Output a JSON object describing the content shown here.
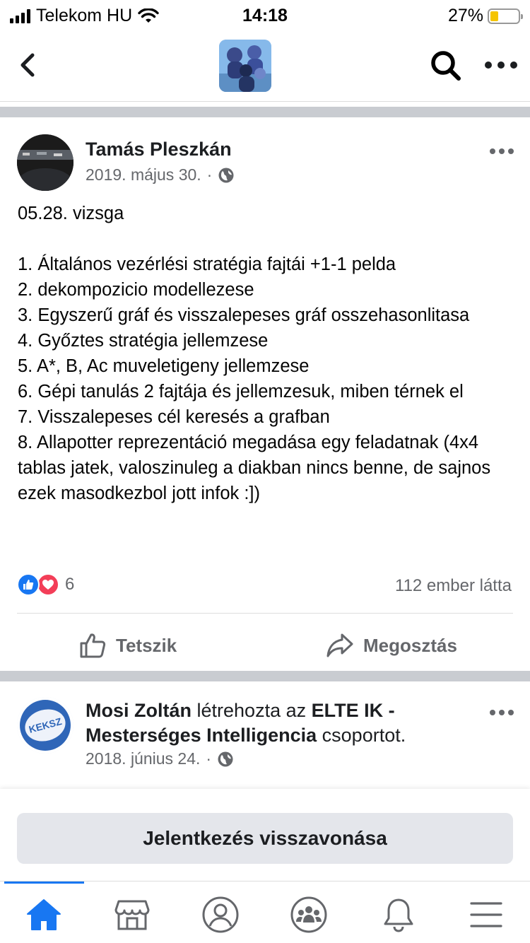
{
  "status_bar": {
    "carrier": "Telekom HU",
    "time": "14:18",
    "battery_percent": "27%",
    "battery_level": 0.27
  },
  "nav": {
    "icons": [
      "back-chevron-icon",
      "group-cover-image",
      "search-icon",
      "more-horizontal-icon"
    ]
  },
  "post": {
    "author": "Tamás Pleszkán",
    "date": "2019. május 30.",
    "separator": "·",
    "audience_icon": "globe-icon",
    "body_lines": [
      "05.28. vizsga",
      "",
      "1. Általános vezérlési stratégia fajtái +1-1 pelda",
      "2. dekompozicio modellezese",
      "3. Egyszerű gráf és visszalepeses gráf osszehasonlitasa",
      "4. Győztes stratégia jellemzese",
      "5. A*, B, Ac muveletigeny jellemzese",
      "6. Gépi tanulás 2 fajtája és jellemzesuk, miben térnek el",
      "7. Visszalepeses cél keresés a grafban",
      "8. Allapotter reprezentáció megadása egy feladatnak (4x4 tablas jatek, valoszinuleg a diakban nincs benne, de sajnos ezek masodkezbol jott infok :])"
    ],
    "reaction_count": "6",
    "reaction_types": [
      "like",
      "love"
    ],
    "seen_by": "112 ember látta",
    "actions": {
      "like": "Tetszik",
      "share": "Megosztás"
    }
  },
  "story2": {
    "actor": "Mosi Zoltán",
    "verb": "létrehozta az",
    "group": "ELTE IK - Mesterséges Intelligencia",
    "suffix": "csoportot.",
    "date": "2018. június 24.",
    "separator": "·",
    "avatar_text": "KEKSZ"
  },
  "cancel_button": "Jelentkezés visszavonása",
  "tab_bar": {
    "tabs": [
      "home-icon",
      "marketplace-icon",
      "profile-icon",
      "groups-icon",
      "notifications-icon",
      "menu-icon"
    ],
    "active": "home-icon"
  },
  "colors": {
    "accent": "#1877f2",
    "love": "#f33e58",
    "secondary_text": "#65676b",
    "separator": "#c9ccd1",
    "button_bg": "#e4e6eb"
  }
}
